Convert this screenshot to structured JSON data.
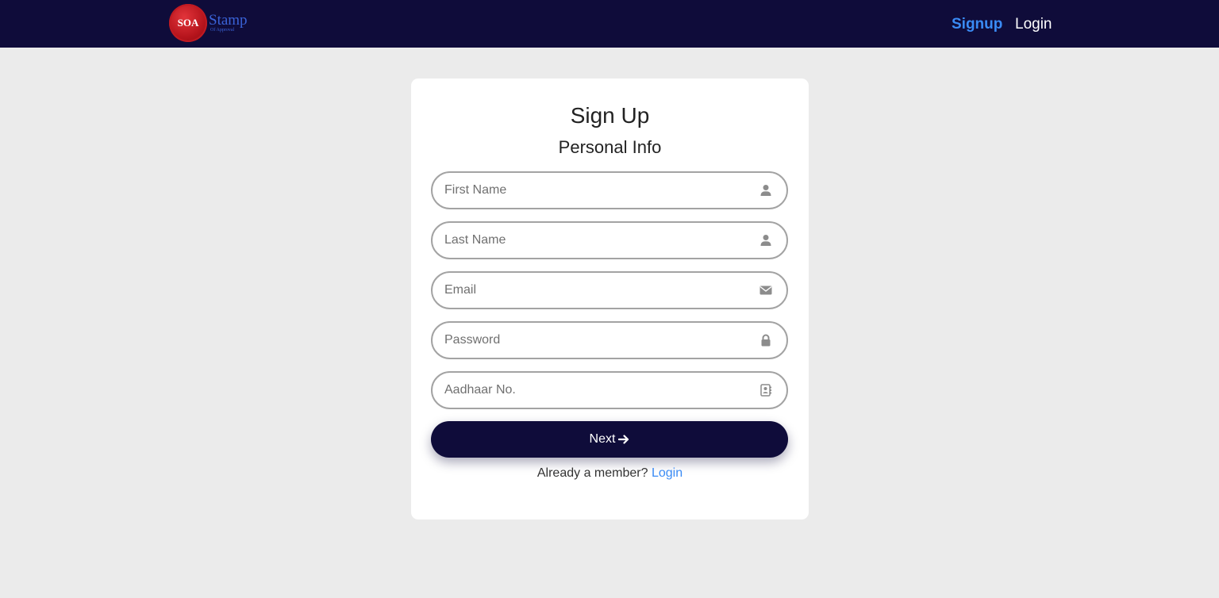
{
  "nav": {
    "logo_seal_text": "SOA",
    "logo_word": "Stamp",
    "logo_sub": "Of Approval",
    "links": [
      {
        "label": "Signup",
        "active": true
      },
      {
        "label": "Login",
        "active": false
      }
    ],
    "background_color": "#0f0c3a"
  },
  "form": {
    "title": "Sign Up",
    "subtitle": "Personal Info",
    "fields": [
      {
        "placeholder": "First Name",
        "value": "",
        "icon": "user-icon"
      },
      {
        "placeholder": "Last Name",
        "value": "",
        "icon": "user-icon"
      },
      {
        "placeholder": "Email",
        "value": "",
        "icon": "envelope-icon"
      },
      {
        "placeholder": "Password",
        "value": "",
        "icon": "lock-icon"
      },
      {
        "placeholder": "Aadhaar No.",
        "value": "",
        "icon": "address-book-icon"
      }
    ],
    "next_label": "Next",
    "member_text": "Already a member?",
    "member_link": "Login"
  },
  "colors": {
    "accent": "#3a8bf5",
    "primary": "#0f0c3a",
    "page_background": "#ebebeb"
  }
}
